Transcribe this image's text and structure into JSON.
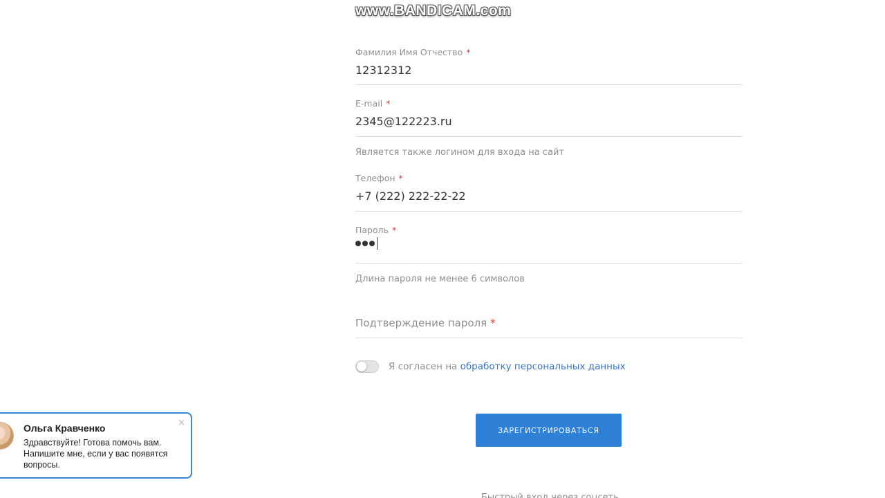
{
  "watermark": "www.BANDICAM.com",
  "form": {
    "full_name": {
      "label": "Фамилия Имя Отчество",
      "required": "*",
      "value": "12312312"
    },
    "email": {
      "label": "E-mail",
      "required": "*",
      "value": "2345@122223.ru",
      "hint": "Является также логином для входа на сайт"
    },
    "phone": {
      "label": "Телефон",
      "required": "*",
      "value": "+7 (222) 222-22-22"
    },
    "password": {
      "label": "Пароль",
      "required": "*",
      "masked_length": 3,
      "hint": "Длина пароля не менее 6 символов"
    },
    "password_confirm": {
      "placeholder": "Подтверждение пароля",
      "required": "*"
    },
    "consent": {
      "text": "Я согласен на ",
      "link_text": "обработку персональных данных",
      "checked": false
    },
    "submit_label": "ЗАРЕГИСТРИРОВАТЬСЯ",
    "quick_login": "Быстрый вход через соцсеть"
  },
  "chat": {
    "name": "Ольга Кравченко",
    "message": "Здравствуйте! Готова помочь вам. Напишите мне, если у вас появятся вопросы.",
    "close_icon": "×"
  },
  "colors": {
    "accent": "#2f80d7",
    "required": "#e03b3b",
    "link": "#3a74c4",
    "chat_border": "#3a85d6"
  }
}
